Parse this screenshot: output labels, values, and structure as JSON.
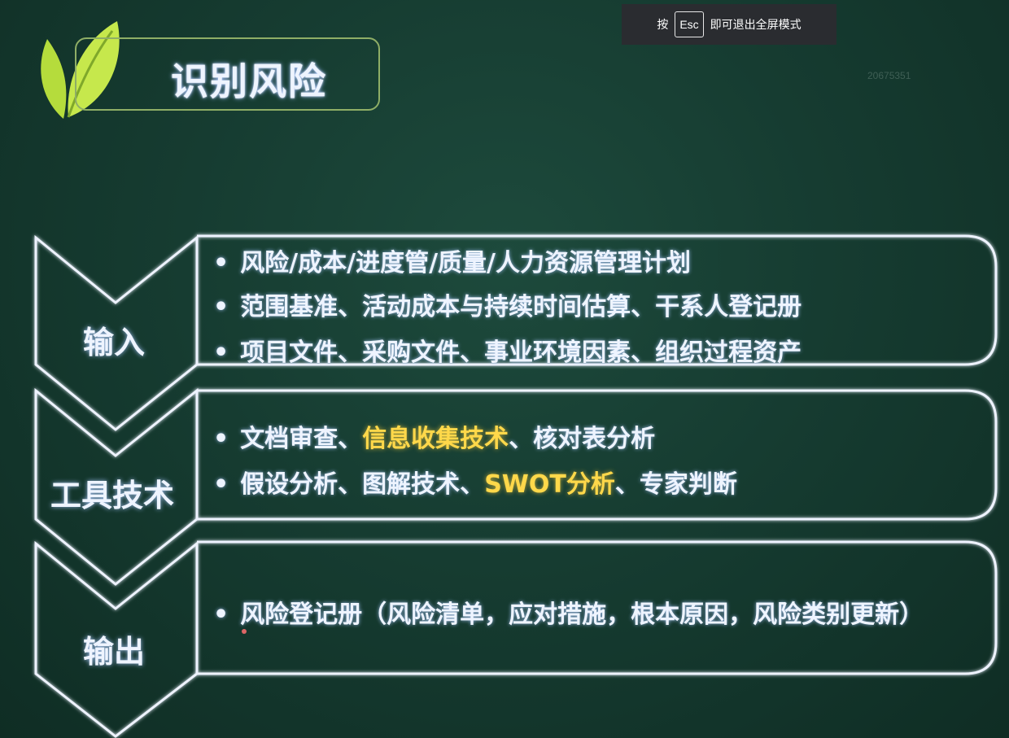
{
  "overlay": {
    "press": "按",
    "key": "Esc",
    "message": "即可退出全屏模式"
  },
  "watermark": "20675351",
  "title": "识别风险",
  "sections": [
    {
      "label": "输入",
      "items": [
        "风险/成本/进度管/质量/人力资源管理计划",
        "范围基准、活动成本与持续时间估算、干系人登记册",
        "项目文件、采购文件、事业环境因素、组织过程资产"
      ]
    },
    {
      "label": "工具技术",
      "items": [
        {
          "parts": [
            "文档审查、",
            "信息收集技术",
            "、核对表分析"
          ]
        },
        {
          "parts": [
            "假设分析、图解技术、",
            "SWOT分析",
            "、专家判断"
          ]
        }
      ]
    },
    {
      "label": "输出",
      "items": [
        "风险登记册（风险清单，应对措施，根本原因，风险类别更新）"
      ]
    }
  ],
  "colors": {
    "background": "#163c31",
    "highlight": "#ffd84a",
    "leaf": "#b5dc3c",
    "title_border": "#8fae66"
  }
}
